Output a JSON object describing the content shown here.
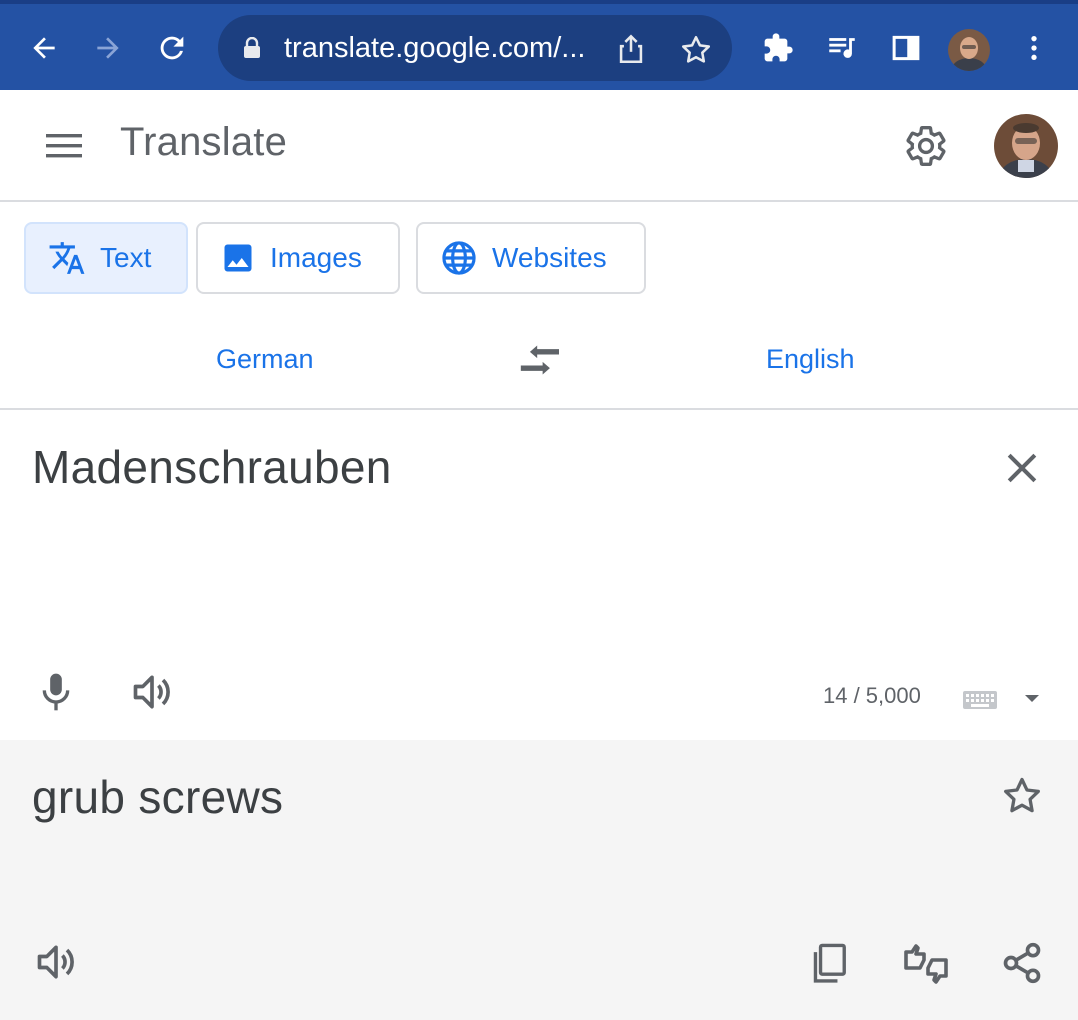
{
  "browser": {
    "url": "translate.google.com/...",
    "accent": "#2452a4"
  },
  "app": {
    "title": "Translate"
  },
  "modes": [
    {
      "label": "Text",
      "icon": "translate-icon",
      "active": true
    },
    {
      "label": "Images",
      "icon": "image-icon",
      "active": false
    },
    {
      "label": "Websites",
      "icon": "globe-icon",
      "active": false
    }
  ],
  "languages": {
    "source": "German",
    "target": "English"
  },
  "source": {
    "text": "Madenschrauben",
    "char_count": "14 / 5,000"
  },
  "result": {
    "text": "grub screws"
  },
  "colors": {
    "link_blue": "#1a73e8",
    "result_bg": "#f5f5f5",
    "text": "#3c4043"
  }
}
